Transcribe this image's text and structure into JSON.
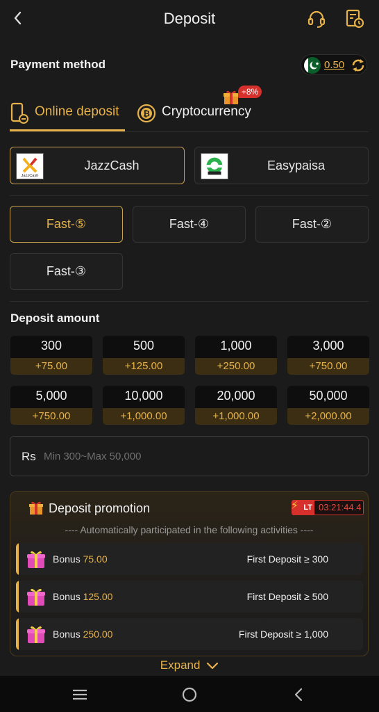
{
  "header": {
    "title": "Deposit",
    "icons": [
      "back-icon",
      "headset-icon",
      "history-icon"
    ]
  },
  "payment": {
    "title": "Payment method",
    "balance": "0.50",
    "flag": "pakistan-flag-icon"
  },
  "tabs": [
    {
      "label": "Online deposit",
      "icon": "phone-deposit-icon",
      "active": true
    },
    {
      "label": "Cryptocurrency",
      "icon": "bitcoin-icon",
      "badge": "+8%"
    }
  ],
  "providers": [
    {
      "label": "JazzCash",
      "logo_text": "JazzCash",
      "active": true
    },
    {
      "label": "Easypaisa",
      "active": false
    }
  ],
  "channels": [
    {
      "label": "Fast-⑤",
      "active": true
    },
    {
      "label": "Fast-④",
      "active": false
    },
    {
      "label": "Fast-②",
      "active": false
    },
    {
      "label": "Fast-③",
      "active": false
    }
  ],
  "deposit": {
    "title": "Deposit amount",
    "amounts": [
      {
        "value": "300",
        "bonus": "+75.00"
      },
      {
        "value": "500",
        "bonus": "+125.00"
      },
      {
        "value": "1,000",
        "bonus": "+250.00"
      },
      {
        "value": "3,000",
        "bonus": "+750.00"
      },
      {
        "value": "5,000",
        "bonus": "+750.00"
      },
      {
        "value": "10,000",
        "bonus": "+1,000.00"
      },
      {
        "value": "20,000",
        "bonus": "+1,000.00"
      },
      {
        "value": "50,000",
        "bonus": "+2,000.00"
      }
    ],
    "input_prefix": "Rs",
    "input_placeholder": "Min 300~Max 50,000"
  },
  "promotion": {
    "title": "Deposit promotion",
    "lt_label": "LT",
    "timer": "03:21:44.4",
    "subtitle": "---- Automatically participated in the following activities ----",
    "rows": [
      {
        "bonus_label": "Bonus",
        "bonus": "75.00",
        "condition": "First Deposit ≥ 300"
      },
      {
        "bonus_label": "Bonus",
        "bonus": "125.00",
        "condition": "First Deposit ≥ 500"
      },
      {
        "bonus_label": "Bonus",
        "bonus": "250.00",
        "condition": "First Deposit ≥ 1,000"
      }
    ],
    "expand_label": "Expand"
  },
  "colors": {
    "accent": "#e8b24a",
    "background": "#1b1b1b",
    "badge": "#d6302c"
  }
}
